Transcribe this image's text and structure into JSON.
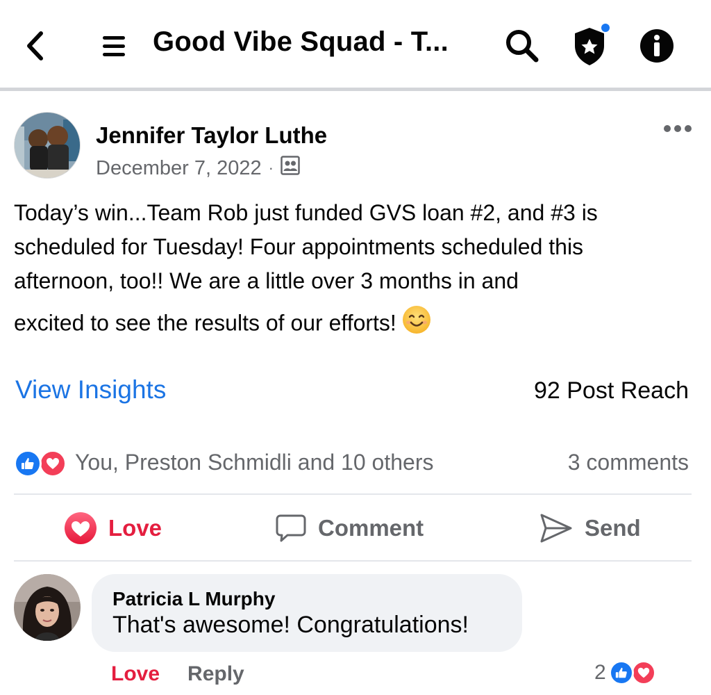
{
  "header": {
    "group_title": "Good Vibe Squad - T...",
    "icons": [
      "back-icon",
      "menu-icon",
      "search-icon",
      "admin-shield-star-icon",
      "info-icon"
    ],
    "notification_dot_color": "#1877f2"
  },
  "post": {
    "author_name": "Jennifer Taylor Luthe",
    "date": "December 7, 2022",
    "meta_separator": "·",
    "audience_icon": "group-members-icon",
    "text_lines": [
      "Today’s win...Team Rob just funded GVS loan #2, and #3 is",
      "scheduled for Tuesday!  Four appointments scheduled this",
      "afternoon, too!!  We are a little over 3 months in and",
      "excited to see the results of our efforts!"
    ],
    "emoji": "smiling-face-icon",
    "view_insights_label": "View Insights",
    "post_reach": "92 Post Reach",
    "reactions_summary": "You, Preston Schmidli and 10 others",
    "comments_count": "3 comments",
    "reaction_icons": [
      "like-icon",
      "love-icon"
    ]
  },
  "actions": {
    "love_label": "Love",
    "comment_label": "Comment",
    "send_label": "Send"
  },
  "comment": {
    "author_name": "Patricia L Murphy",
    "text": "That's awesome! Congratulations!",
    "love_label": "Love",
    "reply_label": "Reply",
    "reaction_count": "2"
  },
  "colors": {
    "accent_blue": "#1b74e4",
    "love_red": "#e41e3f",
    "secondary_text": "#65676b",
    "bubble_bg": "#f0f2f5"
  }
}
